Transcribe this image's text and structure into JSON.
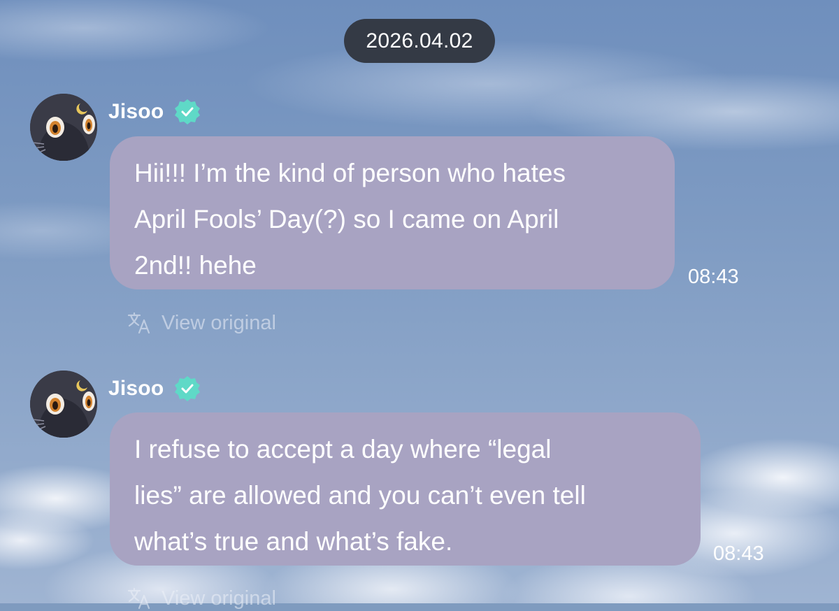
{
  "date_divider": "2026.04.02",
  "theme": {
    "bubble_color": "#a8a3c2",
    "pill_color": "#343a45",
    "verified_color": "#5fd9c7"
  },
  "messages": [
    {
      "sender": "Jisoo",
      "verified": true,
      "avatar": "cat-avatar",
      "lines": [
        "Hii!!! I’m the kind of person who hates",
        "April Fools’ Day(?) so I came on April",
        "2nd!! hehe"
      ],
      "time": "08:43",
      "view_original": "View original"
    },
    {
      "sender": "Jisoo",
      "verified": true,
      "avatar": "cat-avatar",
      "lines": [
        "I refuse to accept a day where “legal",
        "lies” are allowed and you can’t even tell",
        "what’s true and what’s fake."
      ],
      "time": "08:43",
      "view_original": "View original"
    }
  ]
}
